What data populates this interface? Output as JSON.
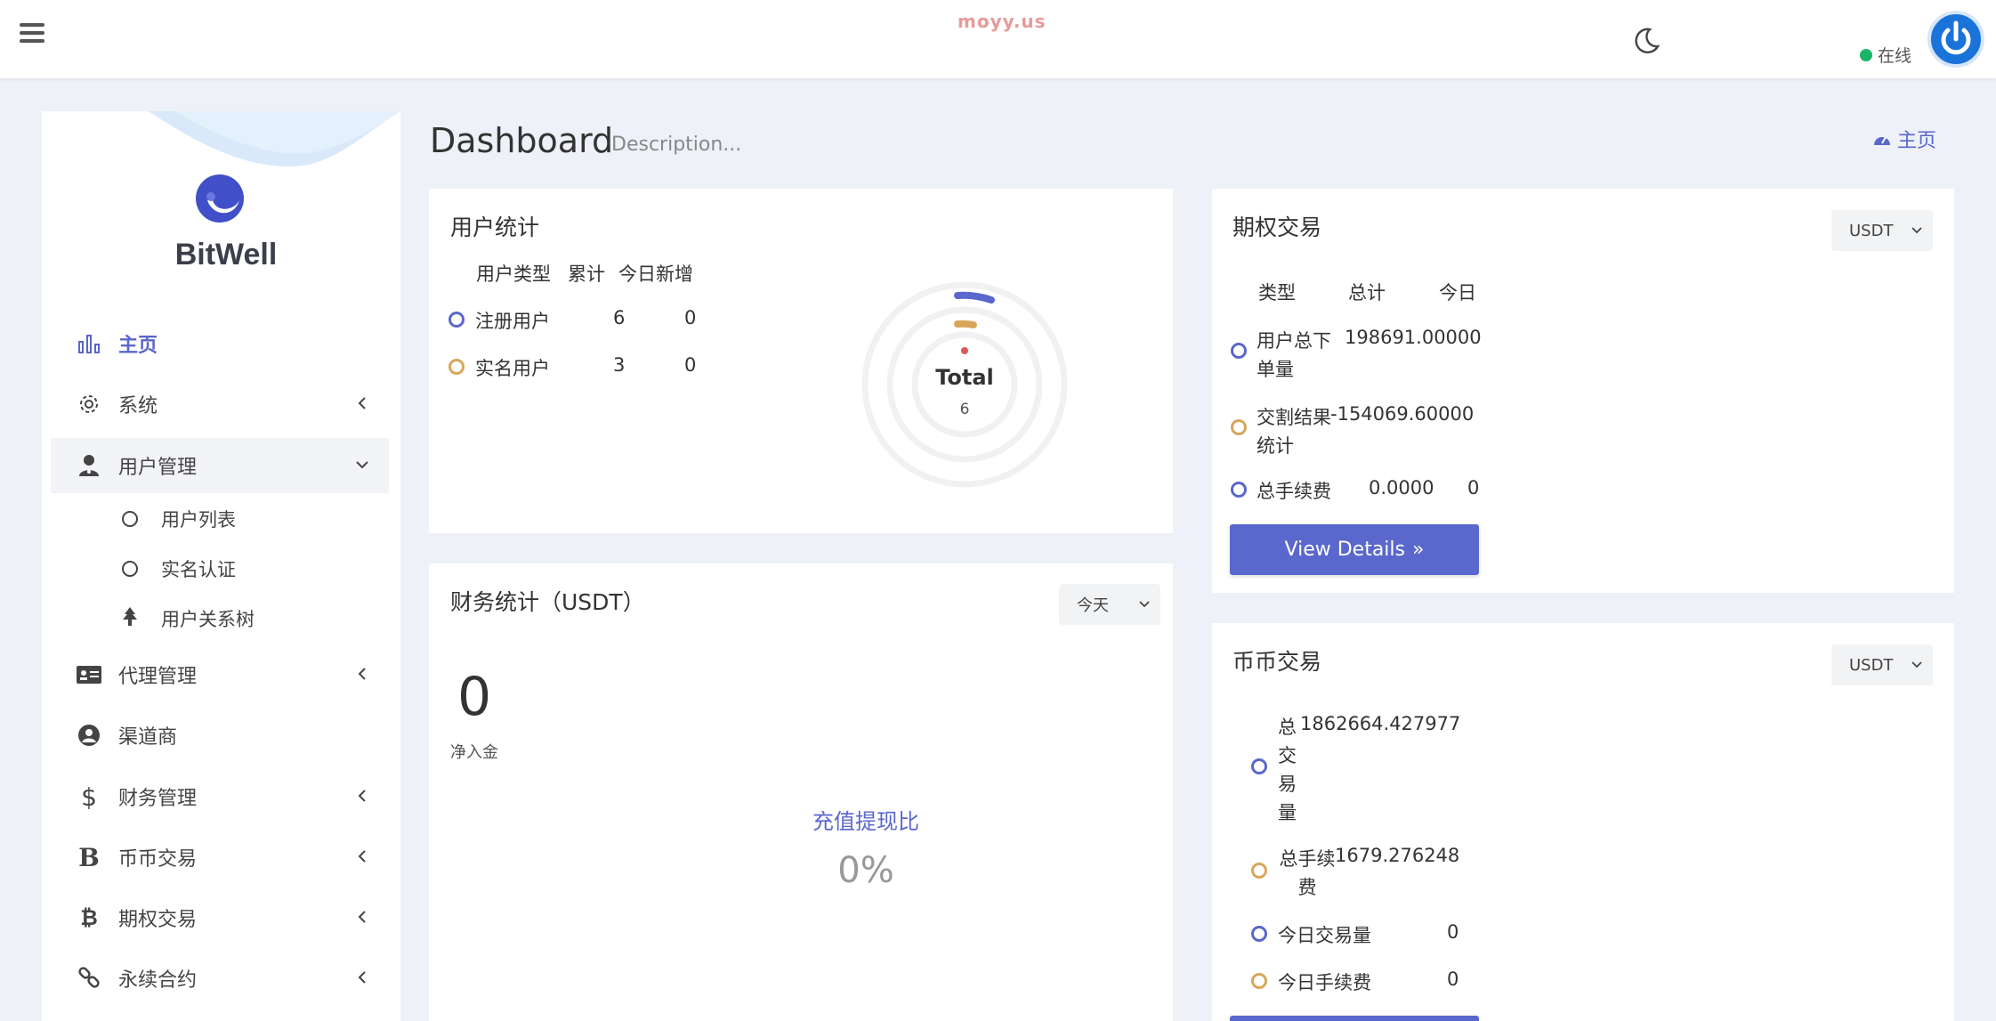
{
  "header": {
    "watermark": "moyy.us",
    "status_label": "在线"
  },
  "sidebar": {
    "brand": "BitWell",
    "items": [
      {
        "label": "主页"
      },
      {
        "label": "系统"
      },
      {
        "label": "用户管理"
      },
      {
        "label": "代理管理"
      },
      {
        "label": "渠道商"
      },
      {
        "label": "财务管理"
      },
      {
        "label": "币币交易"
      },
      {
        "label": "期权交易"
      },
      {
        "label": "永续合约"
      }
    ],
    "sub_items": [
      {
        "label": "用户列表"
      },
      {
        "label": "实名认证"
      },
      {
        "label": "用户关系树"
      }
    ]
  },
  "page": {
    "title": "Dashboard",
    "description": "Description...",
    "breadcrumb": "主页"
  },
  "user_stats": {
    "title": "用户统计",
    "columns": [
      "用户类型",
      "累计",
      "今日新增"
    ],
    "rows": [
      {
        "type": "注册用户",
        "total": "6",
        "today": "0"
      },
      {
        "type": "实名用户",
        "total": "3",
        "today": "0"
      }
    ],
    "chart_label": "Total",
    "chart_value": "6"
  },
  "finance": {
    "title": "财务统计（USDT）",
    "period": "今天",
    "net_inflow_value": "0",
    "net_inflow_label": "净入金",
    "ratio_label": "充值提现比",
    "ratio_value": "0%"
  },
  "options": {
    "title": "期权交易",
    "currency": "USDT",
    "columns": [
      "类型",
      "总计",
      "今日"
    ],
    "rows": [
      {
        "label_line1": "用户总下",
        "label_line2": "单量",
        "total": "198691.00000",
        "today": ""
      },
      {
        "label_line1": "交割结果",
        "label_line2": "统计",
        "total": "-154069.60000",
        "today": ""
      },
      {
        "label_line1": "总手续费",
        "label_line2": "",
        "total": "0.0000",
        "today": "0"
      }
    ],
    "button": "View Details"
  },
  "spot": {
    "title": "币币交易",
    "currency": "USDT",
    "rows": [
      {
        "label_chars": [
          "总",
          "交",
          "易",
          "量"
        ],
        "value": "1862664.427977"
      },
      {
        "label_line1": "总手续",
        "label_line2": "费",
        "value": "1679.276248"
      },
      {
        "label": "今日交易量",
        "value": "0"
      },
      {
        "label": "今日手续费",
        "value": "0"
      }
    ]
  }
}
